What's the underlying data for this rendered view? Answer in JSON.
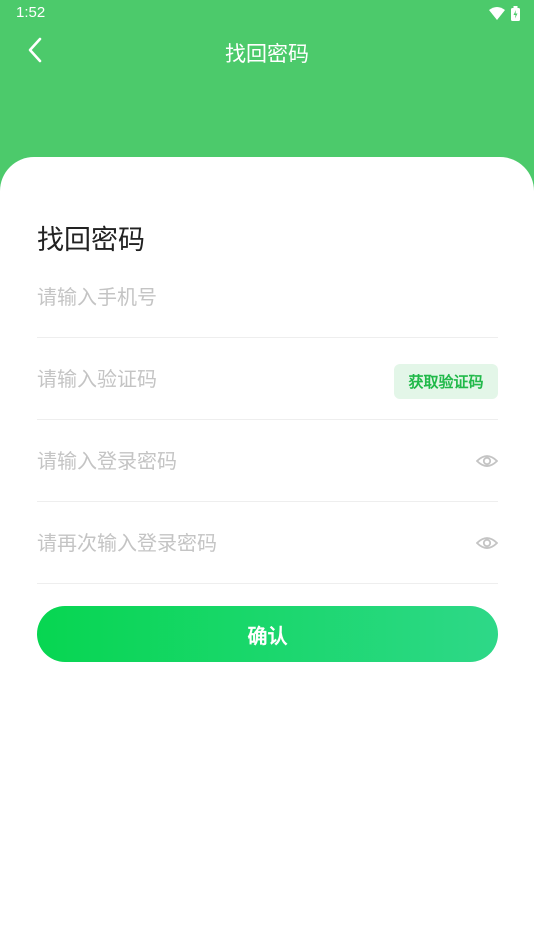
{
  "status_bar": {
    "time": "1:52",
    "icons": [
      "wifi-icon",
      "battery-icon"
    ]
  },
  "nav": {
    "back_icon": "chevron-left-icon",
    "title": "找回密码"
  },
  "form": {
    "title": "找回密码",
    "phone_placeholder": "请输入手机号",
    "code_placeholder": "请输入验证码",
    "get_code_label": "获取验证码",
    "password_placeholder": "请输入登录密码",
    "confirm_password_placeholder": "请再次输入登录密码",
    "password_toggle_icon": "eye-icon",
    "confirm_label": "确认"
  },
  "colors": {
    "header_green": "#4cca6b",
    "button_gradient_start": "#07d651",
    "button_gradient_end": "#2ed888",
    "code_button_bg": "#e3f6e8",
    "code_button_text": "#21b94a",
    "placeholder": "#c4c4c4"
  }
}
